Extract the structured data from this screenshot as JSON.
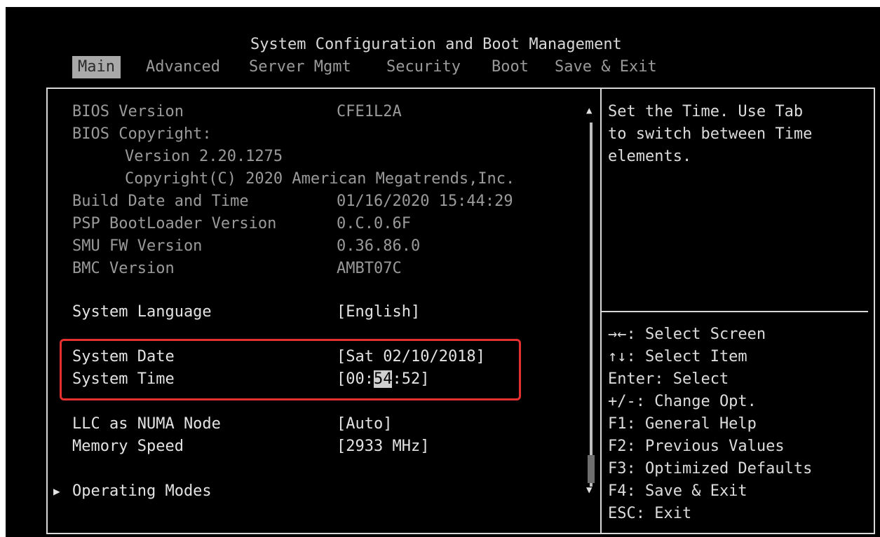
{
  "header": {
    "title": "System Configuration and Boot Management"
  },
  "tabs": [
    {
      "label": "Main",
      "active": true
    },
    {
      "label": "Advanced"
    },
    {
      "label": "Server Mgmt"
    },
    {
      "label": "Security"
    },
    {
      "label": "Boot"
    },
    {
      "label": "Save & Exit"
    }
  ],
  "info": {
    "bios_version_label": "BIOS Version",
    "bios_version_value": "CFE1L2A",
    "bios_copyright_label": "BIOS Copyright:",
    "version_line": "Version 2.20.1275",
    "copyright_line": "Copyright(C) 2020 American Megatrends,Inc.",
    "build_label": "Build Date and Time",
    "build_value": "01/16/2020 15:44:29",
    "psp_label": "PSP BootLoader Version",
    "psp_value": "0.C.0.6F",
    "smu_label": "SMU FW Version",
    "smu_value": "0.36.86.0",
    "bmc_label": "BMC Version",
    "bmc_value": "AMBT07C"
  },
  "settings": {
    "language_label": "System Language",
    "language_value": "[English]",
    "date_label": "System Date",
    "date_value": "[Sat 02/10/2018]",
    "time_label": "System Time",
    "time_prefix": "[00:",
    "time_selected": "54",
    "time_suffix": ":52]",
    "llc_label": "LLC as NUMA Node",
    "llc_value": "[Auto]",
    "mem_label": "Memory Speed",
    "mem_value": "[2933 MHz]",
    "op_modes_label": "Operating Modes"
  },
  "help": {
    "line1": "Set the Time. Use Tab",
    "line2": "to switch between Time",
    "line3": "elements."
  },
  "keys": [
    "→←: Select Screen",
    "↑↓: Select Item",
    "Enter: Select",
    "+/-: Change Opt.",
    "F1: General Help",
    "F2: Previous Values",
    "F3: Optimized Defaults",
    "F4: Save & Exit",
    "ESC: Exit"
  ],
  "colors": {
    "highlight_border": "#e53030",
    "active_tab_bg": "#a9a9a9"
  },
  "icons": {
    "submenu": "triangle-right-icon",
    "scroll_up": "triangle-up-icon",
    "scroll_down": "triangle-down-icon"
  }
}
